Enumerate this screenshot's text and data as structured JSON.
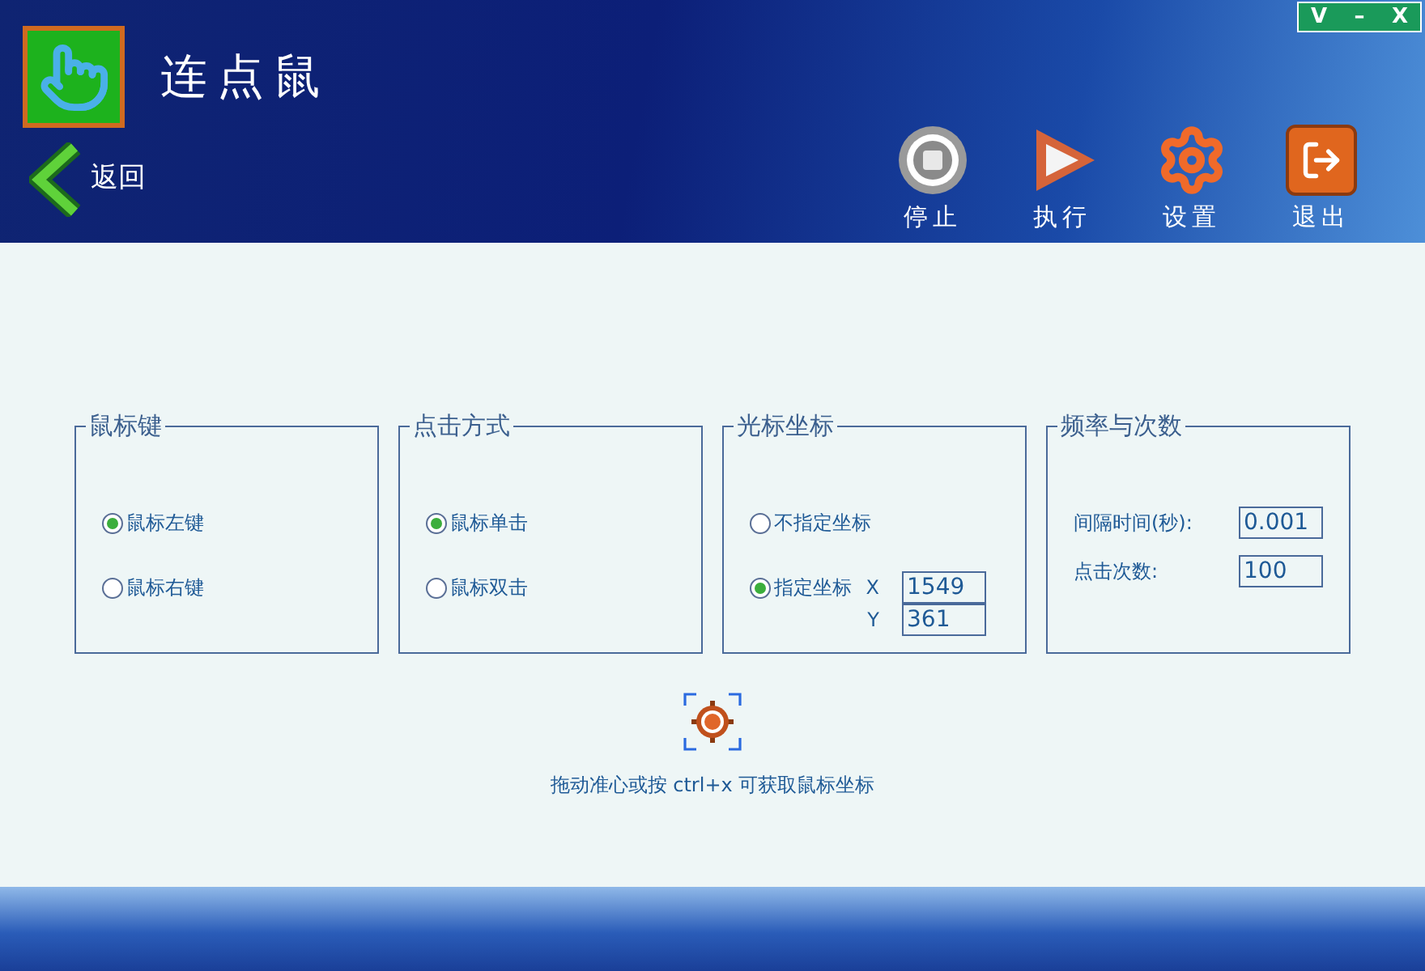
{
  "window": {
    "title": "连点鼠",
    "controls": [
      "V",
      "–",
      "X"
    ]
  },
  "back": {
    "label": "返回"
  },
  "toolbar": [
    {
      "kind": "stop",
      "label": "停止"
    },
    {
      "kind": "run",
      "label": "执行"
    },
    {
      "kind": "settings",
      "label": "设置"
    },
    {
      "kind": "exit",
      "label": "退出"
    }
  ],
  "groups": [
    {
      "title": "鼠标键",
      "options": [
        {
          "label": "鼠标左键",
          "selected": true
        },
        {
          "label": "鼠标右键",
          "selected": false
        }
      ]
    },
    {
      "title": "点击方式",
      "options": [
        {
          "label": "鼠标单击",
          "selected": true
        },
        {
          "label": "鼠标双击",
          "selected": false
        }
      ]
    },
    {
      "title": "光标坐标",
      "options": [
        {
          "label": "不指定坐标",
          "selected": false
        },
        {
          "label": "指定坐标",
          "selected": true
        }
      ],
      "fields": [
        {
          "label": "X",
          "value": "1549"
        },
        {
          "label": "Y",
          "value": "361"
        }
      ]
    },
    {
      "title": "频率与次数",
      "fields": [
        {
          "label": "间隔时间(秒):",
          "value": "0.001"
        },
        {
          "label": "点击次数:",
          "value": "100"
        }
      ]
    }
  ],
  "hint": "拖动准心或按 ctrl+x 可获取鼠标坐标"
}
